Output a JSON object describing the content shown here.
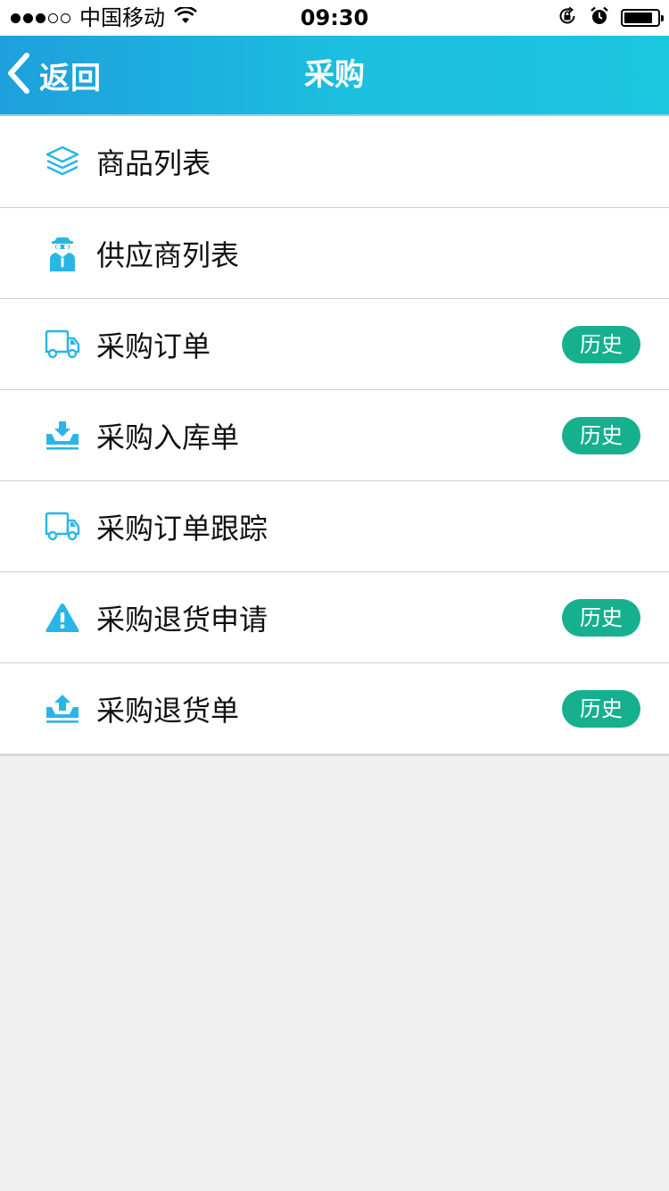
{
  "status_bar": {
    "carrier": "中国移动",
    "time": "09:30",
    "signal_strength": 3,
    "signal_total": 5,
    "battery_level": 0.85
  },
  "nav": {
    "back_label": "返回",
    "title": "采购"
  },
  "colors": {
    "accent": "#1cb4e0",
    "icon": "#29b6e6",
    "badge": "#16b08e"
  },
  "menu": {
    "items": [
      {
        "label": "商品列表",
        "icon": "layers-icon",
        "history": ""
      },
      {
        "label": "供应商列表",
        "icon": "agent-icon",
        "history": ""
      },
      {
        "label": "采购订单",
        "icon": "truck-icon",
        "history": "历史"
      },
      {
        "label": "采购入库单",
        "icon": "inbox-download-icon",
        "history": "历史"
      },
      {
        "label": "采购订单跟踪",
        "icon": "truck-icon",
        "history": ""
      },
      {
        "label": "采购退货申请",
        "icon": "warning-icon",
        "history": "历史"
      },
      {
        "label": "采购退货单",
        "icon": "inbox-upload-icon",
        "history": "历史"
      }
    ]
  }
}
